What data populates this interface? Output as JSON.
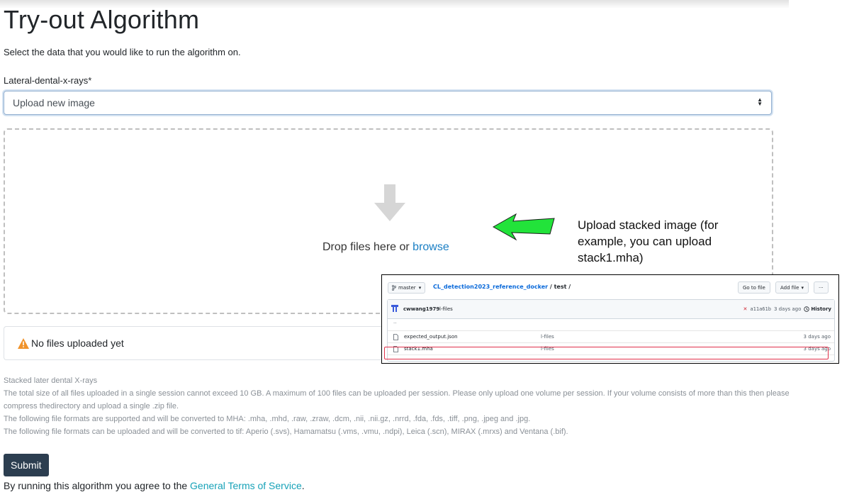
{
  "page": {
    "title": "Try-out Algorithm",
    "subtitle": "Select the data that you would like to run the algorithm on."
  },
  "form": {
    "field_label": "Lateral-dental-x-rays*",
    "select_value": "Upload new image",
    "dropzone": {
      "text": "Drop files here or ",
      "link": "browse"
    },
    "status": "No files uploaded yet",
    "help": {
      "title": "Stacked later dental X-rays",
      "lines": [
        "The total size of all files uploaded in a single session cannot exceed 10 GB. A maximum of 100 files can be uploaded per session. Please only upload one volume per session. If your volume consists of more than this then please compress thedirectory and upload a single .zip file.",
        "The following file formats are supported and will be converted to MHA: .mha, .mhd, .raw, .zraw, .dcm, .nii, .nii.gz, .nrrd, .fda, .fds, .tiff, .png, .jpeg and .jpg.",
        "The following file formats can be uploaded and will be converted to tif: Aperio (.svs), Hamamatsu (.vms, .vmu, .ndpi), Leica (.scn), MIRAX (.mrxs) and Ventana (.bif)."
      ]
    },
    "submit_label": "Submit",
    "terms": {
      "prefix": "By running this algorithm you agree to the ",
      "link": "General Terms of Service",
      "suffix": "."
    }
  },
  "annotation": {
    "callout": "Upload stacked image (for example, you can upload stack1.mha)",
    "arrow_color": "#22e33a"
  },
  "github": {
    "branch": "master",
    "repo": "CL_detection2023_reference_docker",
    "path_rest": " / test /",
    "go_to_file": "Go to file",
    "add_file": "Add file",
    "more": "···",
    "commit": {
      "user": "cwwang1979",
      "message": "l-files",
      "hash": "a11a61b",
      "ago": "3 days ago",
      "history": "History"
    },
    "parent_dir": "..",
    "files": [
      {
        "name": "expected_output.json",
        "message": "l-files",
        "date": "3 days ago"
      },
      {
        "name": "stack1.mha",
        "message": "l-files",
        "date": "3 days ago"
      }
    ]
  },
  "colors": {
    "primary_button": "#2c3e50",
    "link": "#1a7fc4",
    "terms_link": "#17a2b8",
    "warning": "#f0932b",
    "highlight_border": "#e0304a"
  }
}
